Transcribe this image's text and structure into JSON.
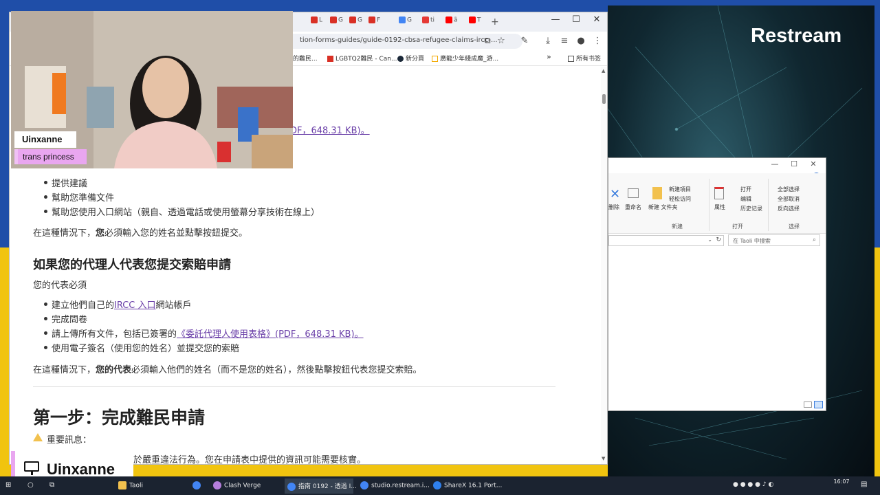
{
  "brand": {
    "name": "Restream"
  },
  "browser": {
    "tabs": [
      {
        "label": "L",
        "color": "#d93025"
      },
      {
        "label": "G",
        "color": "#d93025"
      },
      {
        "label": "G",
        "color": "#d93025"
      },
      {
        "label": "F",
        "color": "#d93025"
      },
      {
        "label": "G",
        "color": "#4285f4"
      },
      {
        "label": "ti",
        "color": "#e53935"
      },
      {
        "label": "ã",
        "color": "#ff0000"
      },
      {
        "label": "T",
        "color": "#ff0000"
      }
    ],
    "url": "tion-forms-guides/guide-0192-cbsa-refugee-claims-ircc-...",
    "bookmarks": [
      {
        "label": "的難民...",
        "icon": "maple"
      },
      {
        "label": "LGBTQ2難民 - Can...",
        "icon": "maple"
      },
      {
        "label": "新分頁",
        "icon": "steam"
      },
      {
        "label": "廣龍少年綫成魔_游...",
        "icon": "folder"
      }
    ],
    "bookmarks_more": "»",
    "all_bookmarks": "所有书签"
  },
  "content": {
    "link_partial": "DF，648.31 KB)。",
    "list1": [
      "提供建議",
      "幫助您準備文件",
      "幫助您使用入口網站（親自、透過電話或使用螢幕分享技術在線上）"
    ],
    "para1_prefix": "在這種情況下，",
    "para1_bold": "您",
    "para1_suffix": "必須輸入您的姓名並點擊按鈕提交。",
    "heading_rep": "如果您的代理人代表您提交索賠申請",
    "rep_intro": "您的代表必須",
    "list2_item1_prefix": "建立他們自己的",
    "list2_item1_link": "IRCC 入口",
    "list2_item1_suffix": "網站帳戶",
    "list2_item2": "完成問卷",
    "list2_item3_prefix": "請上傳所有文件，包括已簽署的",
    "list2_item3_link": "《委託代理人使用表格》(PDF，648.31 KB)。",
    "list2_item4": "使用電子簽名（使用您的姓名）並提交您的索賠",
    "para2_prefix": "在這種情況下，",
    "para2_bold": "您的代表",
    "para2_suffix": "必須輸入他們的姓名（而不是您的姓名），然後點擊按鈕代表您提交索賠。",
    "heading_step1": "第一步：完成難民申請",
    "important": "重要訊息：",
    "bottom_partial": "於嚴重違法行為。您在申請表中提供的資訊可能需要核實。"
  },
  "stream": {
    "display_name": "Uinxanne",
    "pronoun": "trans princess",
    "channel_name": "Uinxanne"
  },
  "explorer": {
    "new_item": "新建項目",
    "easy_access": "轻松访问",
    "new_folder": "新建\n文件夹",
    "delete": "删除",
    "rename": "重命名",
    "properties": "属性",
    "open": "打开",
    "edit": "编辑",
    "history": "历史记录",
    "select_all": "全部选择",
    "select_none": "全部取消",
    "invert_select": "反向选择",
    "group_new": "新建",
    "group_open": "打开",
    "group_select": "选择",
    "search_placeholder": "在 Taoli 中搜索"
  },
  "taskbar": {
    "items": [
      {
        "label": "Taoli",
        "color": "#f2c14e"
      },
      {
        "label": "",
        "color": "#4285f4"
      },
      {
        "label": "Clash Verge",
        "color": "#b57edc"
      },
      {
        "label": "指南 0192 - 透過 I...",
        "color": "#4285f4"
      },
      {
        "label": "studio.restream.i...",
        "color": "#4285f4"
      },
      {
        "label": "ShareX 16.1 Port...",
        "color": "#2f80ed"
      }
    ],
    "time": "16:07"
  },
  "colors": {
    "accent_link": "#6a3fa8",
    "pink": "#e9a6f0",
    "ua_blue": "#1f4ea8",
    "ua_yellow": "#f1c40f"
  }
}
